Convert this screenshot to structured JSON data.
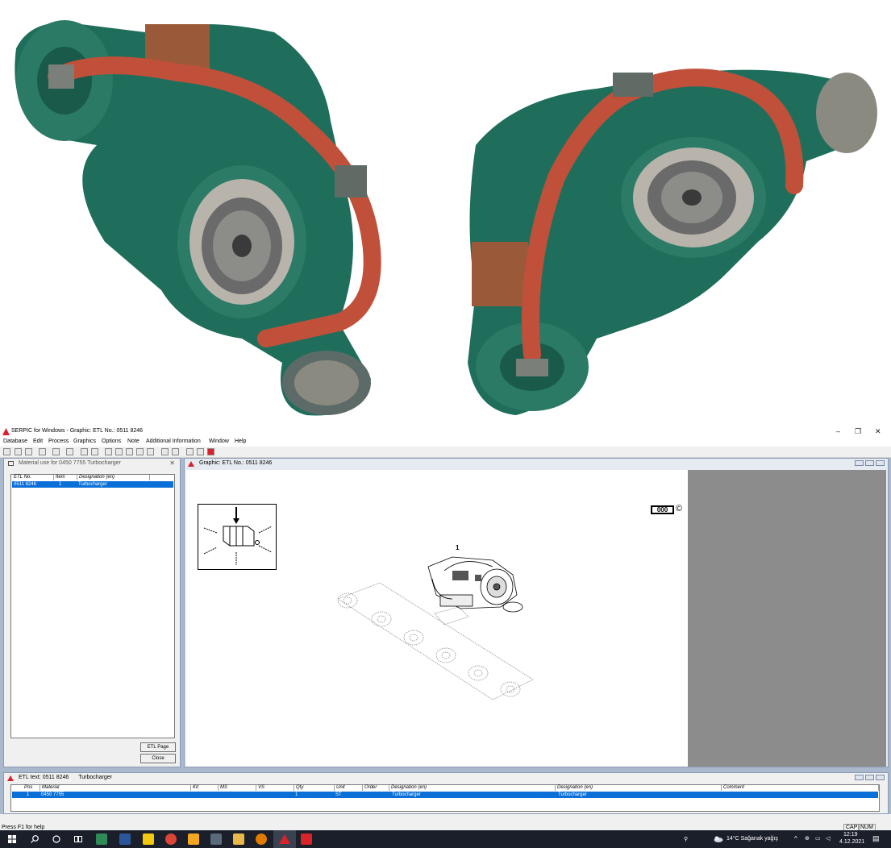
{
  "app": {
    "title": "SERPIC for Windows - Graphic: ETL No.: 0511 8246",
    "menu": [
      "Database",
      "Edit",
      "Process",
      "Graphics",
      "Options",
      "Note",
      "Additional Information",
      "Window",
      "Help"
    ]
  },
  "material_panel": {
    "title": "Material use for 0450 7755 Turbocharger",
    "columns": [
      "ETL No.",
      "Item",
      "Designation (en)"
    ],
    "rows": [
      {
        "etl": "0511 8246",
        "item": "1",
        "designation": "Turbocharger"
      }
    ],
    "etl_page_label": "ETL Page",
    "close_label": "Close"
  },
  "graphic_panel": {
    "title": "Graphic: ETL No.: 0511 8246",
    "callout_number": "1",
    "code_box": "000",
    "copyright": "©"
  },
  "etl_text_panel": {
    "title": "ETL text: 0511 8246",
    "subtitle": "Turbocharger",
    "columns": [
      "Pos",
      "Material",
      "Kit",
      "MS",
      "VS",
      "Qty",
      "Unit",
      "Order",
      "Designation (en)",
      "Designation (en)",
      "Comment"
    ],
    "rows": [
      {
        "pos": "1",
        "material": "0450 7755",
        "kit": "",
        "ms": "",
        "vs": "",
        "qty": "1",
        "unit": "ST",
        "order": "",
        "designation1": "Turbocharger",
        "designation2": "Turbocharger",
        "comment": ""
      }
    ]
  },
  "status": {
    "help": "Press F1 for help",
    "cap": "CAP",
    "num": "NUM"
  },
  "taskbar": {
    "weather": "14°C  Sağanak yağış",
    "time": "12:19",
    "date": "4.12.2021"
  },
  "colors": {
    "turbo_green": "#1f6e5c",
    "hose_red": "#c0503a",
    "selection_blue": "#0a6fd6",
    "mdi_background": "#a9b8cc"
  }
}
